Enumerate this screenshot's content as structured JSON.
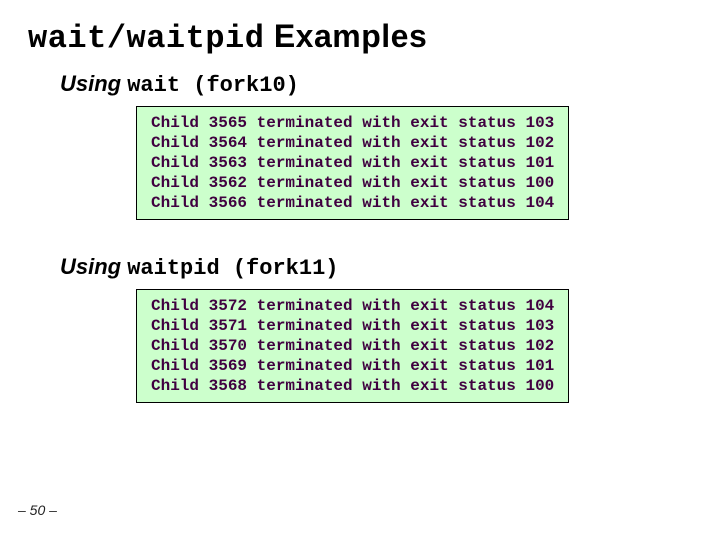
{
  "title": {
    "mono": "wait/waitpid",
    "rest": " Examples"
  },
  "section1": {
    "prefix": "Using ",
    "mono": "wait (fork10)"
  },
  "section2": {
    "prefix": "Using ",
    "mono": "waitpid (fork11)"
  },
  "output1": [
    "Child 3565 terminated with exit status 103",
    "Child 3564 terminated with exit status 102",
    "Child 3563 terminated with exit status 101",
    "Child 3562 terminated with exit status 100",
    "Child 3566 terminated with exit status 104"
  ],
  "output2": [
    "Child 3572 terminated with exit status 104",
    "Child 3571 terminated with exit status 103",
    "Child 3570 terminated with exit status 102",
    "Child 3569 terminated with exit status 101",
    "Child 3568 terminated with exit status 100"
  ],
  "page_num": "– 50 –"
}
